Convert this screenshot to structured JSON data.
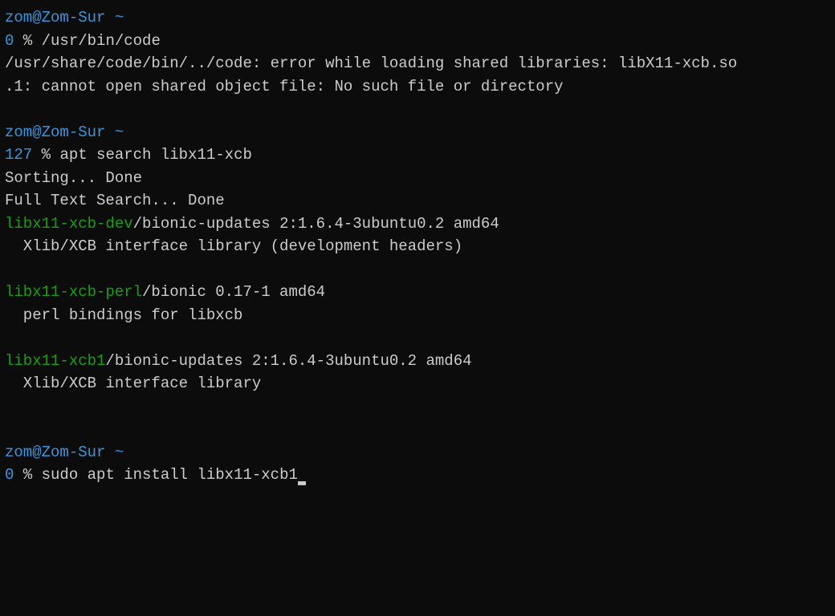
{
  "colors": {
    "bg": "#0c0c0c",
    "fg": "#cccccc",
    "cyan": "#3a96dd",
    "green": "#13a10e"
  },
  "session1": {
    "userhost": "zom@Zom-Sur",
    "tilde": " ~",
    "exitcode": "0",
    "prompt": " % ",
    "command": "/usr/bin/code",
    "output1": "/usr/share/code/bin/../code: error while loading shared libraries: libX11-xcb.so",
    "output2": ".1: cannot open shared object file: No such file or directory"
  },
  "session2": {
    "userhost": "zom@Zom-Sur",
    "tilde": " ~",
    "exitcode": "127",
    "prompt": " % ",
    "command": "apt search libx11-xcb",
    "output1": "Sorting... Done",
    "output2": "Full Text Search... Done",
    "pkg1_name": "libx11-xcb-dev",
    "pkg1_meta": "/bionic-updates 2:1.6.4-3ubuntu0.2 amd64",
    "pkg1_desc": "  Xlib/XCB interface library (development headers)",
    "pkg2_name": "libx11-xcb-perl",
    "pkg2_meta": "/bionic 0.17-1 amd64",
    "pkg2_desc": "  perl bindings for libxcb",
    "pkg3_name": "libx11-xcb1",
    "pkg3_meta": "/bionic-updates 2:1.6.4-3ubuntu0.2 amd64",
    "pkg3_desc": "  Xlib/XCB interface library"
  },
  "session3": {
    "userhost": "zom@Zom-Sur",
    "tilde": " ~",
    "exitcode": "0",
    "prompt": " % ",
    "command": "sudo apt install libx11-xcb1"
  }
}
